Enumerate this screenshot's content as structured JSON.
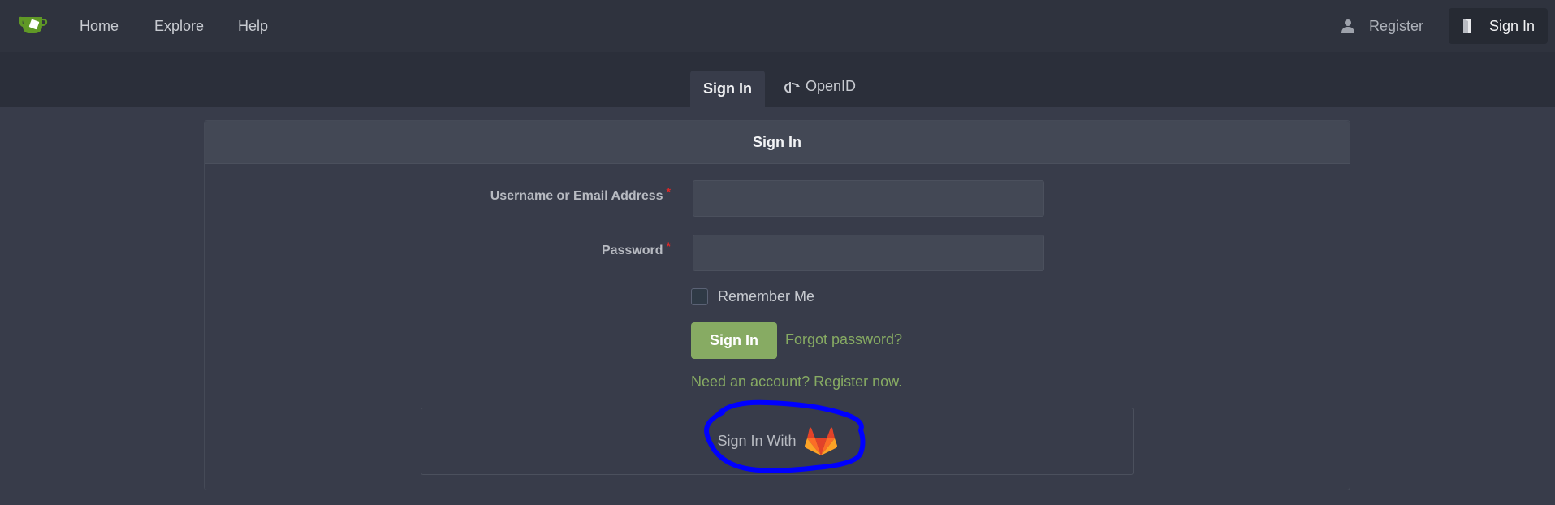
{
  "navbar": {
    "logo_icon": "gitea-tea-icon",
    "home": "Home",
    "explore": "Explore",
    "help": "Help",
    "register": "Register",
    "signin": "Sign In"
  },
  "tabs": {
    "signin": "Sign In",
    "openid": "OpenID"
  },
  "card": {
    "title": "Sign In",
    "username_label": "Username or Email Address",
    "username_value": "",
    "password_label": "Password",
    "password_value": "",
    "required_marker": "*",
    "remember_me": "Remember Me",
    "remember_checked": false,
    "signin_button": "Sign In",
    "forgot_password": "Forgot password?",
    "need_account": "Need an account? Register now.",
    "sign_in_with": "Sign In With",
    "oauth_provider_icon": "gitlab-icon"
  },
  "colors": {
    "accent": "#87ab63",
    "navbar_bg": "#2f333e",
    "page_bg": "#383c4a",
    "annotation": "#0000ff"
  }
}
